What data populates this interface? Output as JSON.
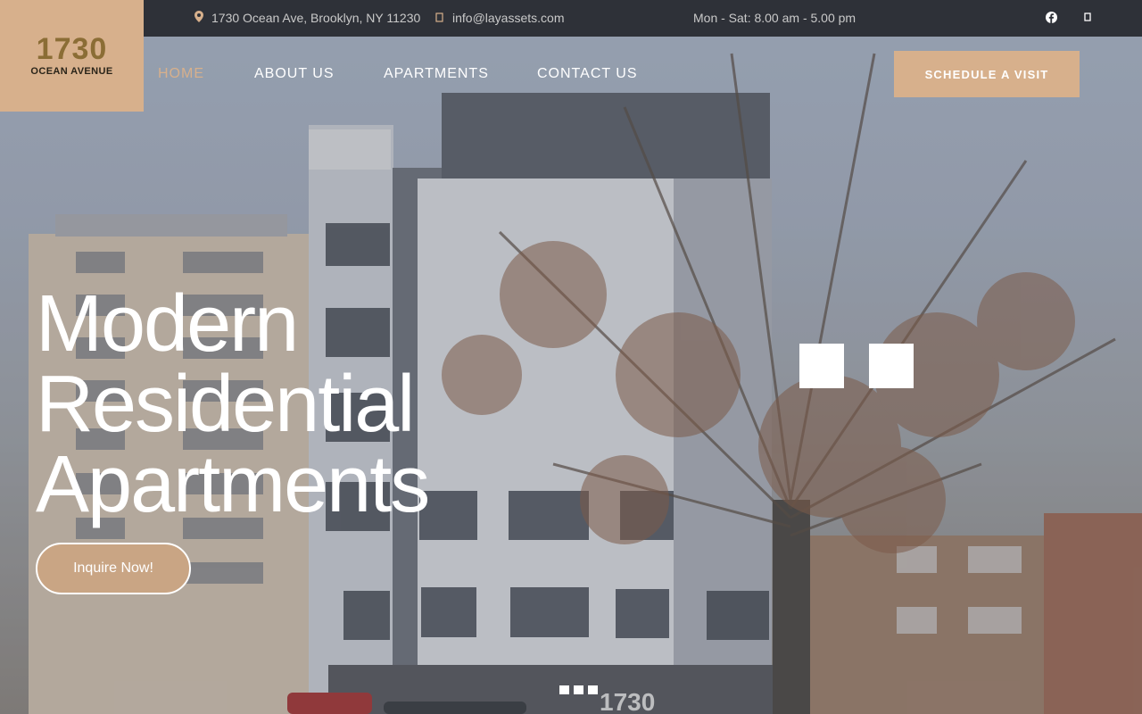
{
  "colors": {
    "accent": "#d7b08c",
    "topbar": "#2e3138"
  },
  "topbar": {
    "address": "1730 Ocean Ave, Brooklyn, NY 11230",
    "email": "info@layassets.com",
    "hours": "Mon - Sat: 8.00 am - 5.00 pm",
    "icons": [
      "map-pin-icon",
      "envelope-icon",
      "facebook-icon",
      "instagram-icon"
    ]
  },
  "logo": {
    "number": "1730",
    "subtitle": "OCEAN AVENUE"
  },
  "nav": {
    "items": [
      {
        "label": "HOME",
        "active": true
      },
      {
        "label": "ABOUT US",
        "active": false
      },
      {
        "label": "APARTMENTS",
        "active": false
      },
      {
        "label": "CONTACT US",
        "active": false
      }
    ],
    "cta": "SCHEDULE A VISIT"
  },
  "hero": {
    "headline": [
      "Modern",
      "Residential",
      "Apartments"
    ],
    "button": "Inquire Now!",
    "slides_total": 3,
    "building_sign": "1730"
  }
}
